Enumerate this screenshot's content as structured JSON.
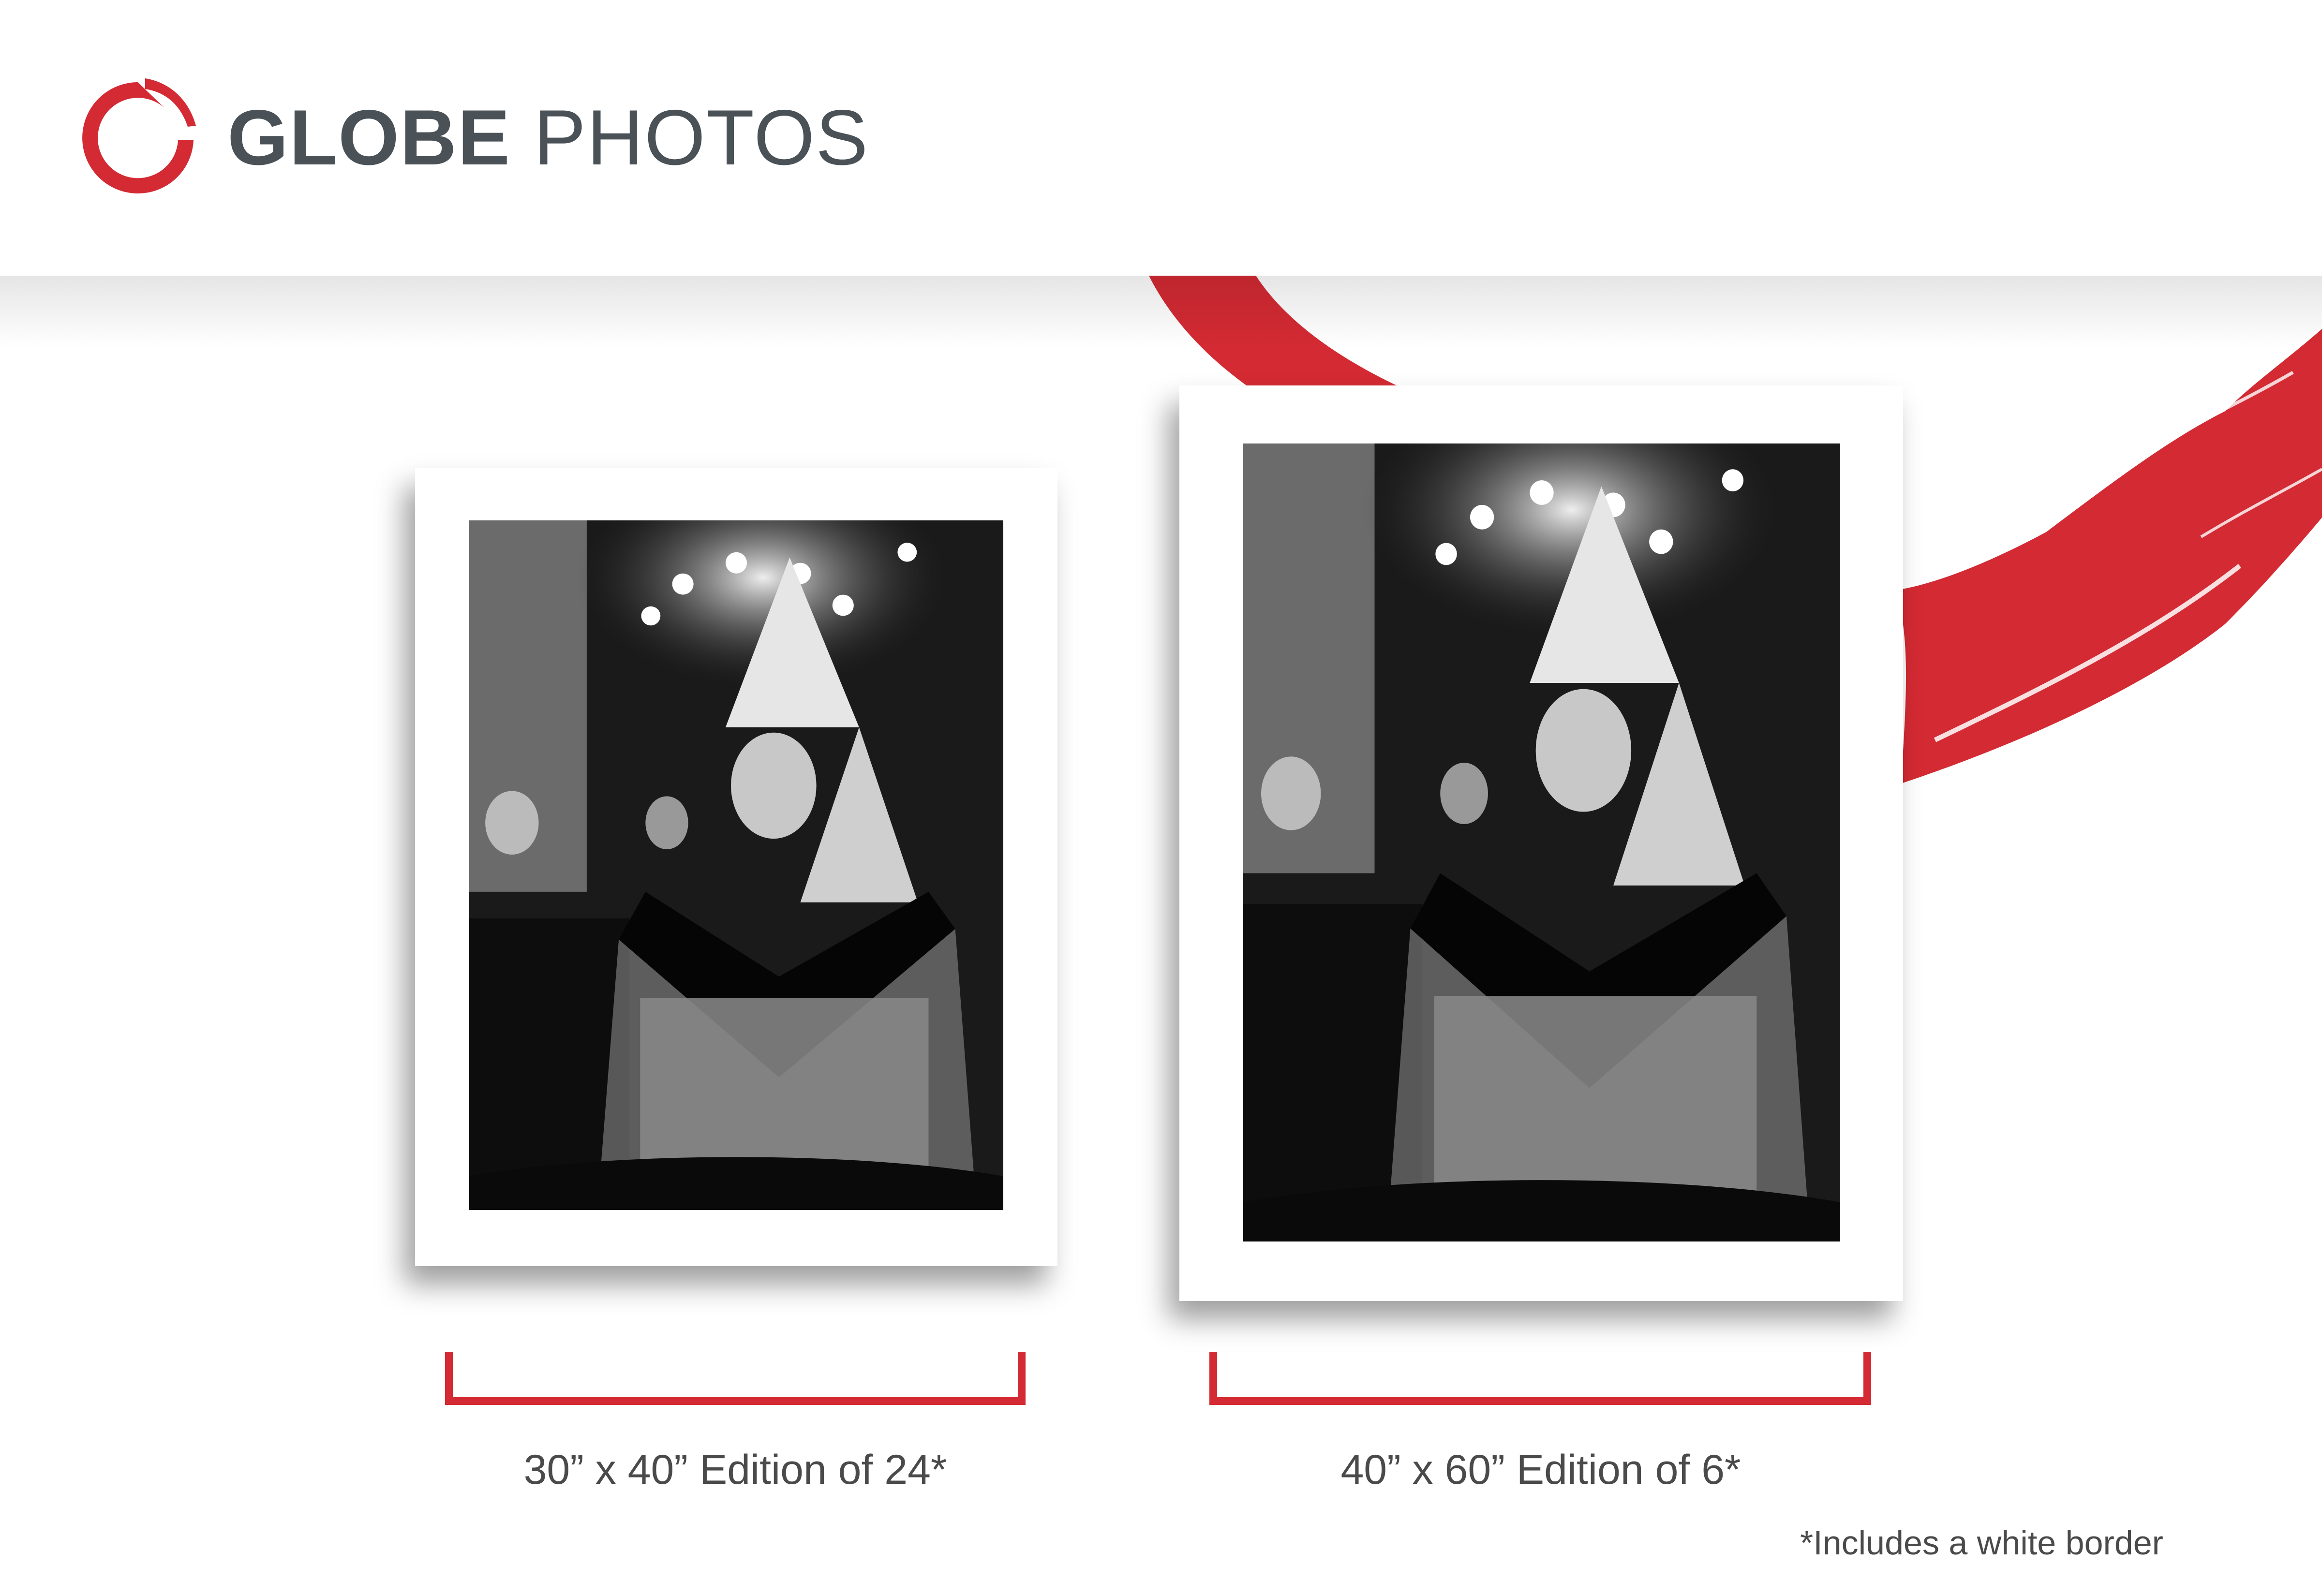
{
  "brand": {
    "name_bold": "GLOBE",
    "name_light": "PHOTOS",
    "logo_icon": "globe-brush-circle-icon",
    "accent_color": "#d42a33",
    "text_color": "#4a5257"
  },
  "prints": [
    {
      "caption": "30” x 40” Edition of 24*"
    },
    {
      "caption": "40” x 60” Edition of 6*"
    }
  ],
  "footnote": "*Includes a white border",
  "colors": {
    "bracket": "#d42a33",
    "caption": "#4a4a4a",
    "brush": "#d42a33"
  }
}
